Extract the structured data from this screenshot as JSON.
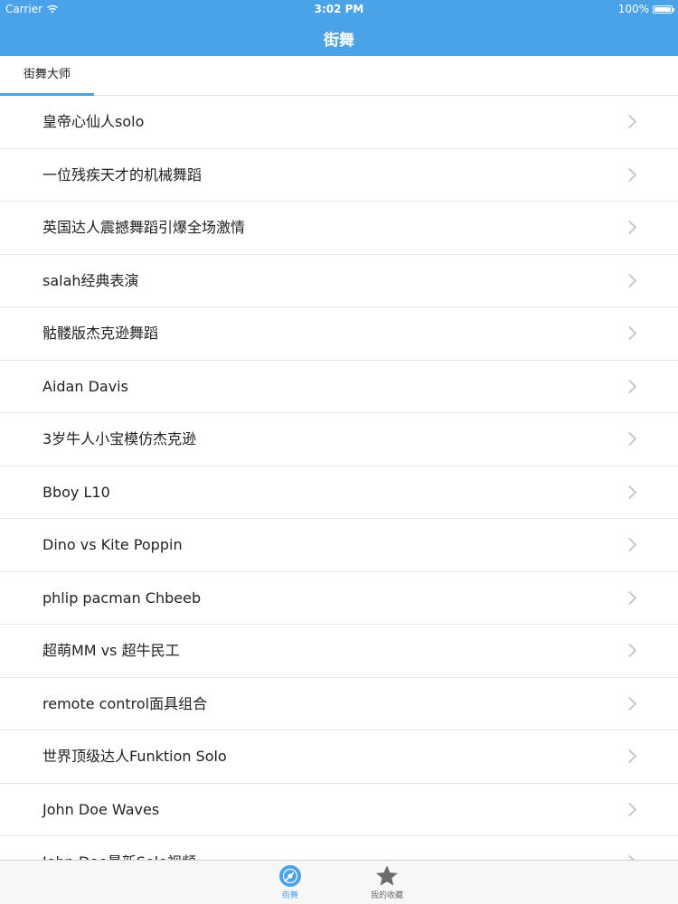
{
  "status_bar": {
    "carrier": "Carrier",
    "time": "3:02 PM",
    "battery": "100%",
    "battery_level": 1.0,
    "icons": [
      "wifi-icon",
      "battery-icon"
    ]
  },
  "nav": {
    "title": "街舞"
  },
  "tabs": [
    {
      "label": "街舞大师",
      "active": true
    }
  ],
  "list": {
    "items": [
      {
        "title": "皇帝心仙人solo"
      },
      {
        "title": "一位残疾天才的机械舞蹈"
      },
      {
        "title": "英国达人震撼舞蹈引爆全场激情"
      },
      {
        "title": "salah经典表演"
      },
      {
        "title": "骷髅版杰克逊舞蹈"
      },
      {
        "title": "Aidan Davis"
      },
      {
        "title": "3岁牛人小宝模仿杰克逊"
      },
      {
        "title": "Bboy L10"
      },
      {
        "title": "Dino vs Kite Poppin"
      },
      {
        "title": "phlip pacman Chbeeb"
      },
      {
        "title": "超萌MM vs 超牛民工"
      },
      {
        "title": "remote control面具组合"
      },
      {
        "title": "世界顶级达人Funktion Solo"
      },
      {
        "title": "John Doe Waves"
      },
      {
        "title": "John Doe最新Solo视频"
      }
    ],
    "chevron_icon": "chevron-right-icon"
  },
  "tabbar": {
    "items": [
      {
        "label": "街舞",
        "icon": "disc-icon",
        "active": true
      },
      {
        "label": "我的收藏",
        "icon": "star-icon",
        "active": false
      }
    ]
  },
  "colors": {
    "accent": "#4aa3e8",
    "separator": "#e6e6e6",
    "chevron": "#c7c7cc",
    "text": "#222222",
    "tabbar_inactive": "#6b6b6b"
  }
}
